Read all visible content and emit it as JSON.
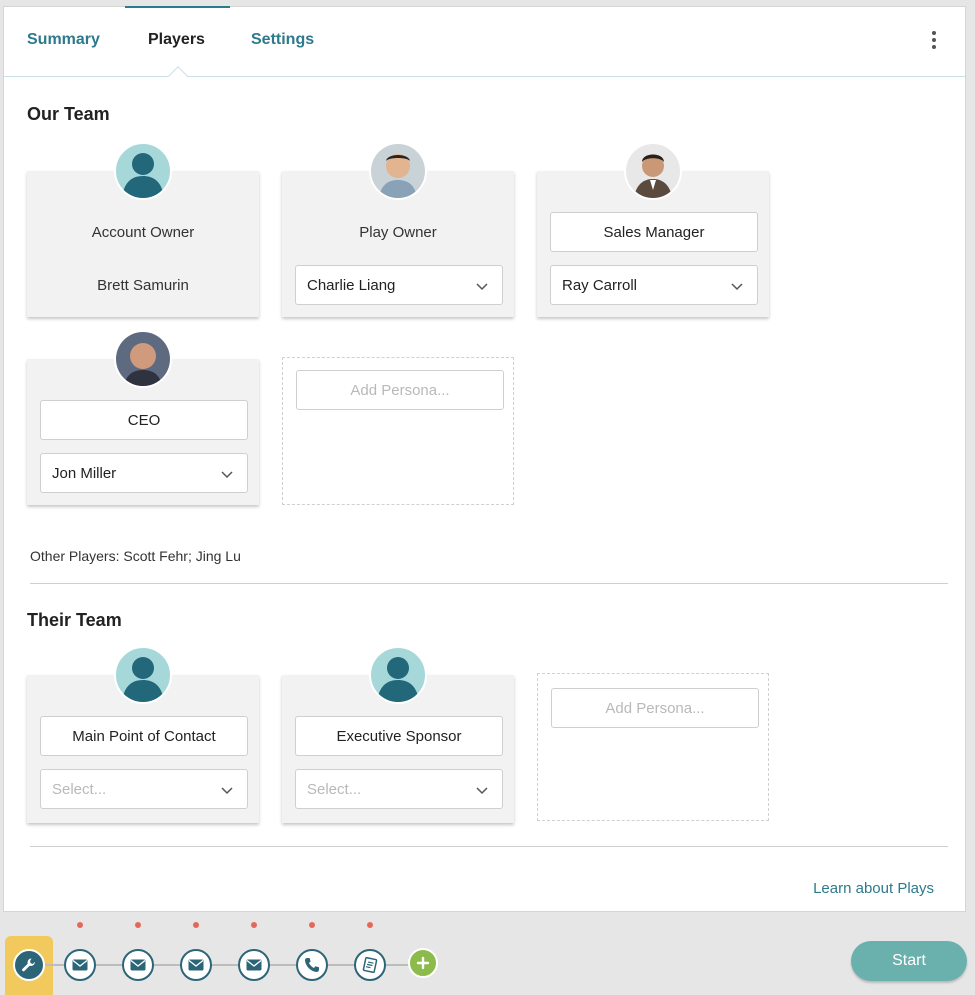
{
  "tabs": [
    {
      "label": "Summary",
      "active": false
    },
    {
      "label": "Players",
      "active": true
    },
    {
      "label": "Settings",
      "active": false
    }
  ],
  "our_team": {
    "title": "Our Team",
    "cards": [
      {
        "role": "Account Owner",
        "person": "Brett Samurin",
        "avatar": "generic-person-icon"
      },
      {
        "role": "Play Owner",
        "person": "Charlie Liang",
        "avatar": "photo"
      },
      {
        "role": "Sales Manager",
        "person": "Ray Carroll",
        "avatar": "photo"
      },
      {
        "role": "CEO",
        "person": "Jon Miller",
        "avatar": "photo"
      }
    ],
    "add_persona_placeholder": "Add Persona...",
    "other_players": "Other Players: Scott Fehr; Jing Lu"
  },
  "their_team": {
    "title": "Their Team",
    "cards": [
      {
        "role": "Main Point of Contact",
        "select_placeholder": "Select...",
        "avatar": "generic-person-icon"
      },
      {
        "role": "Executive Sponsor",
        "select_placeholder": "Select...",
        "avatar": "generic-person-icon"
      }
    ],
    "add_persona_placeholder": "Add Persona..."
  },
  "learn_link": "Learn about Plays",
  "bottom_bar": {
    "steps": [
      "wrench-icon",
      "email-icon",
      "email-icon",
      "email-icon",
      "email-icon",
      "phone-icon",
      "task-icon"
    ],
    "add_icon": "plus-icon",
    "start_label": "Start"
  },
  "colors": {
    "accent": "#2c7a8c",
    "avatar_bg": "#a6d8d9",
    "avatar_fg": "#22677a",
    "notification_dot": "#e4685a",
    "start_button": "#6ab0ad",
    "add_button": "#8dbb4b",
    "wrench_tab": "#f2c95c"
  }
}
